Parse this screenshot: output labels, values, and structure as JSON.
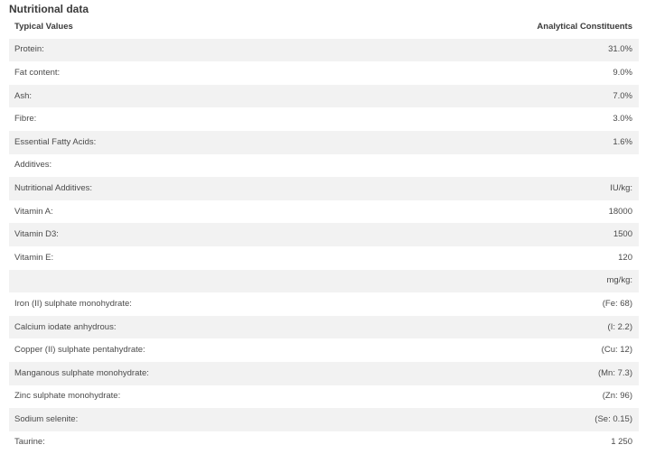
{
  "section": {
    "title": "Nutritional data"
  },
  "table": {
    "headers": {
      "label": "Typical Values",
      "value": "Analytical Constituents"
    },
    "rows": [
      {
        "label": "Protein:",
        "value": "31.0%"
      },
      {
        "label": "Fat content:",
        "value": "9.0%"
      },
      {
        "label": "Ash:",
        "value": "7.0%"
      },
      {
        "label": "Fibre:",
        "value": "3.0%"
      },
      {
        "label": "Essential Fatty Acids:",
        "value": "1.6%"
      },
      {
        "label": "Additives:",
        "value": ""
      },
      {
        "label": "Nutritional Additives:",
        "value": "IU/kg:"
      },
      {
        "label": "Vitamin A:",
        "value": "18000"
      },
      {
        "label": "Vitamin D3:",
        "value": "1500"
      },
      {
        "label": "Vitamin E:",
        "value": "120"
      },
      {
        "label": "",
        "value": "mg/kg:"
      },
      {
        "label": "Iron (II) sulphate monohydrate:",
        "value": "(Fe: 68)"
      },
      {
        "label": "Calcium iodate anhydrous:",
        "value": "(I: 2.2)"
      },
      {
        "label": "Copper (II) sulphate pentahydrate:",
        "value": "(Cu: 12)"
      },
      {
        "label": "Manganous sulphate monohydrate:",
        "value": "(Mn: 7.3)"
      },
      {
        "label": "Zinc sulphate monohydrate:",
        "value": "(Zn: 96)"
      },
      {
        "label": "Sodium selenite:",
        "value": "(Se: 0.15)"
      },
      {
        "label": "Taurine:",
        "value": "1 250"
      }
    ]
  },
  "colors": {
    "stripe": "#f2f2f2",
    "text": "#4a4a4a"
  }
}
